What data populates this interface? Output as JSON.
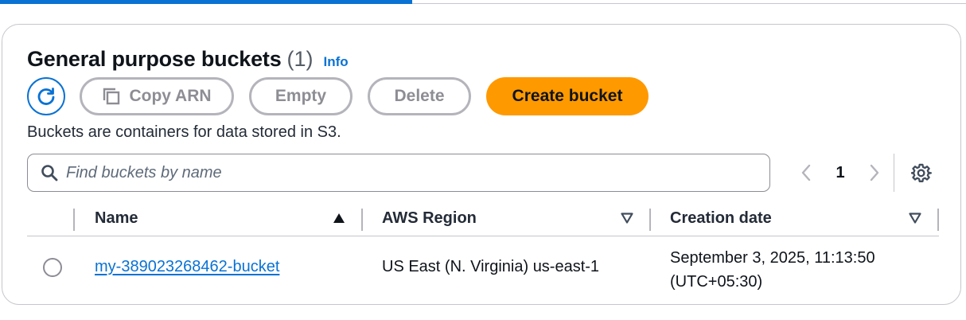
{
  "header": {
    "title": "General purpose buckets",
    "count": "(1)",
    "info_label": "Info"
  },
  "actions": {
    "copy_arn_label": "Copy ARN",
    "empty_label": "Empty",
    "delete_label": "Delete",
    "create_label": "Create bucket"
  },
  "description": "Buckets are containers for data stored in S3.",
  "search": {
    "placeholder": "Find buckets by name",
    "value": ""
  },
  "pagination": {
    "current_page": "1"
  },
  "table": {
    "columns": [
      "Name",
      "AWS Region",
      "Creation date"
    ],
    "rows": [
      {
        "name": "my-389023268462-bucket",
        "region": "US East (N. Virginia) us-east-1",
        "created_line1": "September 3, 2025, 11:13:50",
        "created_line2": "(UTC+05:30)"
      }
    ]
  },
  "icons": [
    "refresh-icon",
    "copy-icon",
    "search-icon",
    "chevron-left-icon",
    "chevron-right-icon",
    "gear-icon",
    "sort-ascending-icon",
    "sort-descending-icon"
  ],
  "colors": {
    "accent": "#0972d3",
    "primary_button": "#ff9900",
    "disabled_text": "#8d8d94",
    "border": "#c6c6cd"
  }
}
